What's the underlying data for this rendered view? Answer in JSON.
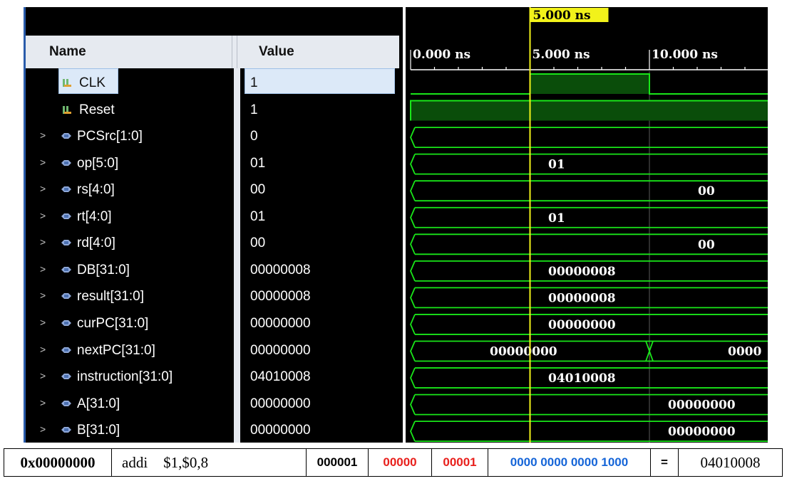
{
  "columns": {
    "name": "Name",
    "value": "Value"
  },
  "signals": [
    {
      "name": "CLK",
      "value": "1",
      "kind": "bit",
      "expandable": false,
      "selected": true
    },
    {
      "name": "Reset",
      "value": "1",
      "kind": "bit",
      "expandable": false,
      "selected": false
    },
    {
      "name": "PCSrc[1:0]",
      "value": "0",
      "kind": "bus",
      "expandable": true,
      "selected": false
    },
    {
      "name": "op[5:0]",
      "value": "01",
      "kind": "bus",
      "expandable": true,
      "selected": false
    },
    {
      "name": "rs[4:0]",
      "value": "00",
      "kind": "bus",
      "expandable": true,
      "selected": false
    },
    {
      "name": "rt[4:0]",
      "value": "01",
      "kind": "bus",
      "expandable": true,
      "selected": false
    },
    {
      "name": "rd[4:0]",
      "value": "00",
      "kind": "bus",
      "expandable": true,
      "selected": false
    },
    {
      "name": "DB[31:0]",
      "value": "00000008",
      "kind": "bus",
      "expandable": true,
      "selected": false
    },
    {
      "name": "result[31:0]",
      "value": "00000008",
      "kind": "bus",
      "expandable": true,
      "selected": false
    },
    {
      "name": "curPC[31:0]",
      "value": "00000000",
      "kind": "bus",
      "expandable": true,
      "selected": false
    },
    {
      "name": "nextPC[31:0]",
      "value": "00000000",
      "kind": "bus",
      "expandable": true,
      "selected": false
    },
    {
      "name": "instruction[31:0]",
      "value": "04010008",
      "kind": "bus",
      "expandable": true,
      "selected": false
    },
    {
      "name": "A[31:0]",
      "value": "00000000",
      "kind": "bus",
      "expandable": true,
      "selected": false
    },
    {
      "name": "B[31:0]",
      "value": "00000000",
      "kind": "bus",
      "expandable": true,
      "selected": false
    }
  ],
  "timeline": {
    "cursor_label": "5.000 ns",
    "cursor_time_ns": 5,
    "ticks": [
      "0.000 ns",
      "5.000 ns",
      "10.000 ns"
    ],
    "tick_times_ns": [
      0,
      5,
      10
    ]
  },
  "waves": [
    {
      "kind": "clock"
    },
    {
      "kind": "high"
    },
    {
      "kind": "bus",
      "label": ""
    },
    {
      "kind": "bus",
      "label": "01"
    },
    {
      "kind": "bus",
      "label": "00"
    },
    {
      "kind": "bus",
      "label": "01"
    },
    {
      "kind": "bus",
      "label": "00"
    },
    {
      "kind": "bus",
      "label": "00000008"
    },
    {
      "kind": "bus",
      "label": "00000008"
    },
    {
      "kind": "bus",
      "label": "00000000"
    },
    {
      "kind": "bus-change",
      "label": "00000000",
      "label2": "0000"
    },
    {
      "kind": "bus",
      "label": "04010008"
    },
    {
      "kind": "bus",
      "label": "00000000"
    },
    {
      "kind": "bus",
      "label": "00000000"
    }
  ],
  "instruction_row": {
    "address": "0x00000000",
    "mnemonic": "addi",
    "operands": "$1,$0,8",
    "op": "000001",
    "rs": "00000",
    "rt": "00001",
    "immediate": "0000 0000 0000 1000",
    "equals": "=",
    "hex": "04010008"
  },
  "colors": {
    "wave": "#19e619",
    "wave_fill": "#0a4d0a",
    "cursor": "#f2f21a",
    "selection": "#dce9f8",
    "rs_rt": "#e8201c",
    "imm": "#1565d8"
  }
}
